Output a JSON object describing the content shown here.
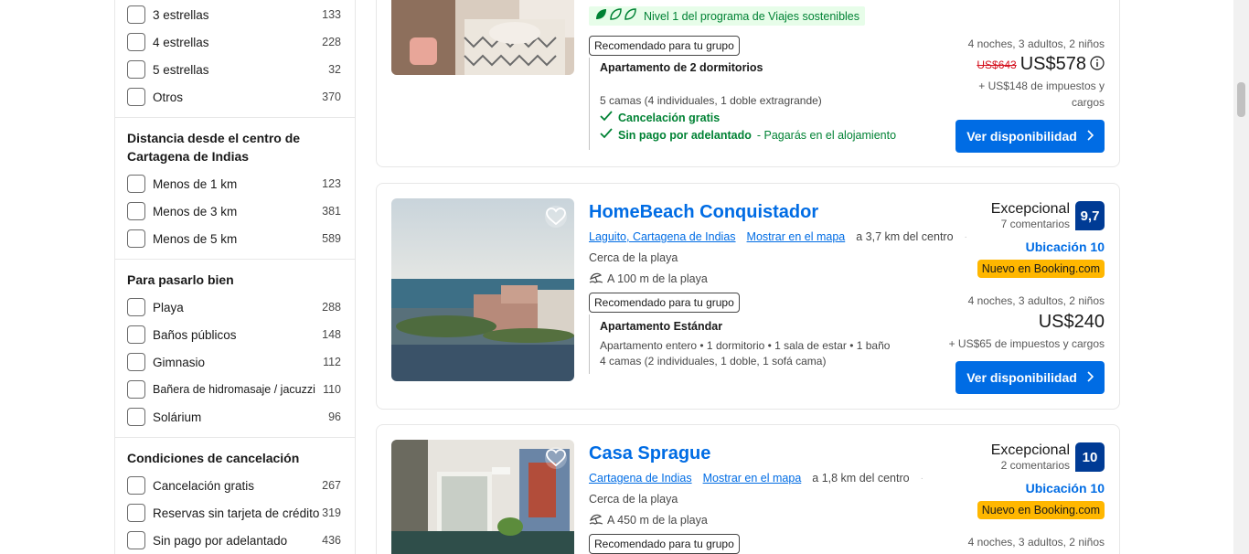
{
  "filters": {
    "stars": [
      {
        "label": "3 estrellas",
        "count": "133"
      },
      {
        "label": "4 estrellas",
        "count": "228"
      },
      {
        "label": "5 estrellas",
        "count": "32"
      },
      {
        "label": "Otros",
        "count": "370"
      }
    ],
    "distance": {
      "title": "Distancia desde el centro de Cartagena de Indias",
      "items": [
        {
          "label": "Menos de 1 km",
          "count": "123"
        },
        {
          "label": "Menos de 3 km",
          "count": "381"
        },
        {
          "label": "Menos de 5 km",
          "count": "589"
        }
      ]
    },
    "fun": {
      "title": "Para pasarlo bien",
      "items": [
        {
          "label": "Playa",
          "count": "288"
        },
        {
          "label": "Baños públicos",
          "count": "148"
        },
        {
          "label": "Gimnasio",
          "count": "112"
        },
        {
          "label": "Bañera de hidromasaje / jacuzzi",
          "count": "110"
        },
        {
          "label": "Solárium",
          "count": "96"
        }
      ]
    },
    "cancel": {
      "title": "Condiciones de cancelación",
      "items": [
        {
          "label": "Cancelación gratis",
          "count": "267"
        },
        {
          "label": "Reservas sin tarjeta de crédito",
          "count": "319"
        },
        {
          "label": "Sin pago por adelantado",
          "count": "436"
        }
      ]
    }
  },
  "cards": [
    {
      "eco": "Nivel 1 del programa de Viajes sostenibles",
      "rec": "Recomendado para tu grupo",
      "unit_title": "Apartamento de 2 dormitorios",
      "beds": "5 camas (4 individuales, 1 doble extragrande)",
      "perk1": "Cancelación gratis",
      "perk2_strong": "Sin pago por adelantado",
      "perk2_light": " - Pagarás en el alojamiento",
      "stay": "4 noches, 3 adultos, 2 niños",
      "old_price": "US$643",
      "price": "US$578",
      "tax_line1": "+ US$148 de impuestos y",
      "tax_line2": "cargos",
      "cta": "Ver disponibilidad"
    },
    {
      "name": "HomeBeach Conquistador",
      "location": "Laguito, Cartagena de Indias",
      "map": "Mostrar en el mapa",
      "distance": "a 3,7 km del centro",
      "near": "Cerca de la playa",
      "beach": "A 100 m de la playa",
      "rec": "Recomendado para tu grupo",
      "unit_title": "Apartamento Estándar",
      "unit_desc": "Apartamento entero • 1 dormitorio • 1 sala de estar • 1 baño",
      "beds": "4 camas (2 individuales, 1 doble, 1 sofá cama)",
      "review_word": "Excepcional",
      "review_count": "7 comentarios",
      "score": "9,7",
      "loc_score": "Ubicación 10",
      "new_badge": "Nuevo en Booking.com",
      "stay": "4 noches, 3 adultos, 2 niños",
      "price": "US$240",
      "tax": "+ US$65 de impuestos y cargos",
      "cta": "Ver disponibilidad"
    },
    {
      "name": "Casa Sprague",
      "location": "Cartagena de Indias",
      "map": "Mostrar en el mapa",
      "distance": "a 1,8 km del centro",
      "near": "Cerca de la playa",
      "beach": "A 450 m de la playa",
      "rec": "Recomendado para tu grupo",
      "review_word": "Excepcional",
      "review_count": "2 comentarios",
      "score": "10",
      "loc_score": "Ubicación 10",
      "new_badge": "Nuevo en Booking.com",
      "stay": "4 noches, 3 adultos, 2 niños"
    }
  ]
}
